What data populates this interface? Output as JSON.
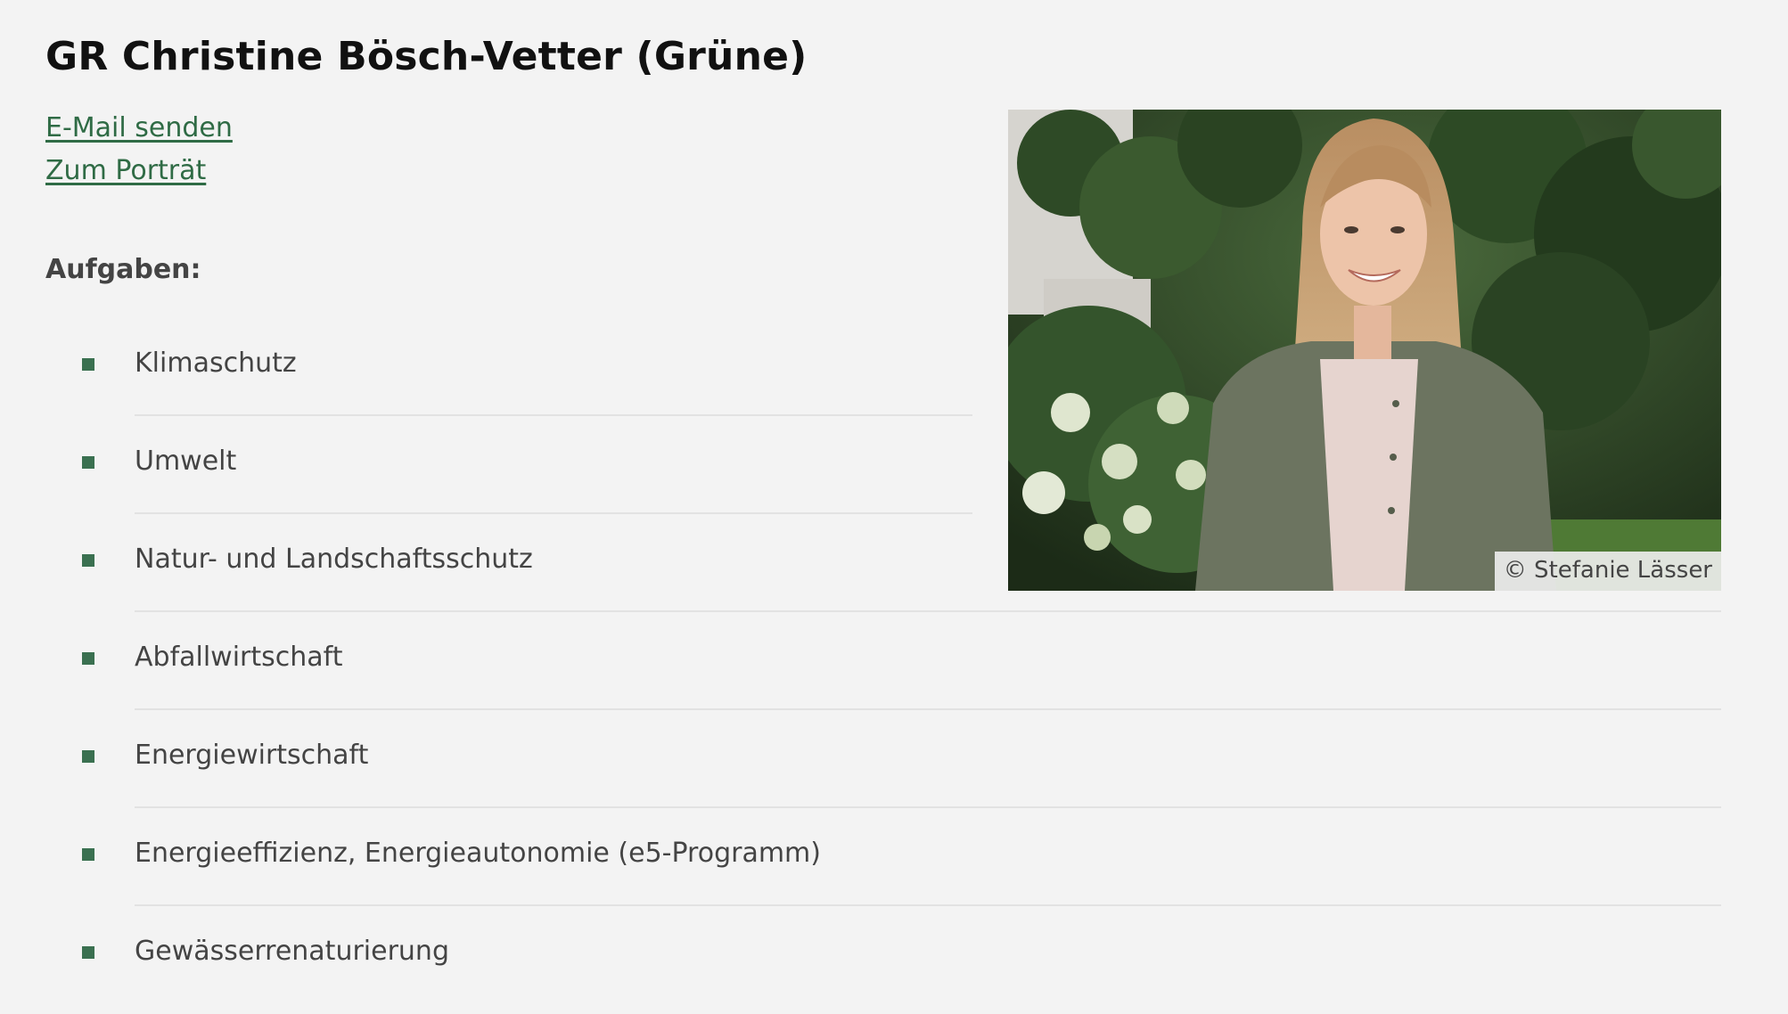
{
  "header": {
    "title": "GR Christine Bösch-Vetter (Grüne)"
  },
  "links": {
    "email": "E-Mail senden",
    "portrait": "Zum Porträt"
  },
  "tasks": {
    "heading": "Aufgaben:",
    "items": [
      "Klimaschutz",
      "Umwelt",
      "Natur- und Landschaftsschutz",
      "Abfallwirtschaft",
      "Energiewirtschaft",
      "Energieeffizienz, Energieautonomie (e5-Programm)",
      "Gewässerrenaturierung"
    ]
  },
  "photo": {
    "credit": "© Stefanie Lässer"
  },
  "colors": {
    "accent": "#2f6b45",
    "background": "#f3f3f3",
    "bullet": "#3a7050"
  }
}
